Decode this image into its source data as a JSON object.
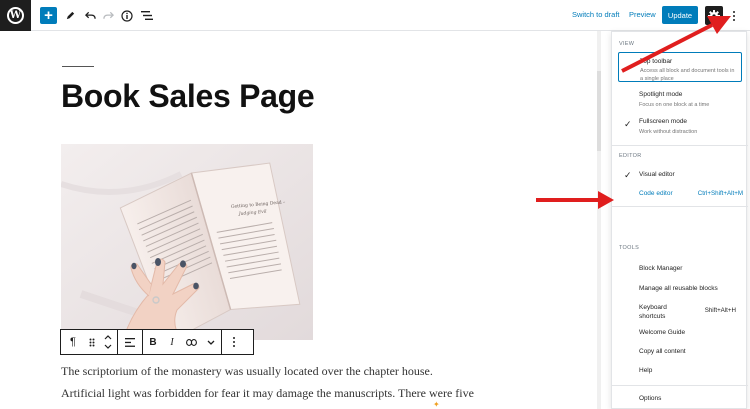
{
  "header": {
    "switch_to_draft": "Switch to draft",
    "preview": "Preview",
    "update": "Update",
    "icons": [
      "wordpress-logo",
      "plus",
      "pencil",
      "undo",
      "redo",
      "info",
      "list-view",
      "gear",
      "more-vertical"
    ]
  },
  "post": {
    "title": "Book Sales Page",
    "image": {
      "book_page_title": "Getting to Being Dead –",
      "book_page_subtitle": "Judging Evil"
    },
    "paragraphs": [
      "The scriptorium of the monastery was usually located over the chapter house.",
      "Artificial light was forbidden for fear it may damage the manuscripts. There were five"
    ]
  },
  "block_toolbar": {
    "icons": [
      "paragraph",
      "drag-handle",
      "move-up-down",
      "align",
      "bold",
      "italic",
      "link",
      "chevron-down",
      "more-vertical"
    ],
    "bold": "B",
    "italic": "I"
  },
  "menu": {
    "view": {
      "heading": "VIEW",
      "items": [
        {
          "label": "Top toolbar",
          "description": "Access all block and document tools in a single place",
          "checked": false,
          "focused": true
        },
        {
          "label": "Spotlight mode",
          "description": "Focus on one block at a time",
          "checked": false
        },
        {
          "label": "Fullscreen mode",
          "description": "Work without distraction",
          "checked": true
        }
      ]
    },
    "editor": {
      "heading": "EDITOR",
      "items": [
        {
          "label": "Visual editor",
          "checked": true
        },
        {
          "label": "Code editor",
          "shortcut": "Ctrl+Shift+Alt+M",
          "highlighted": true
        }
      ]
    },
    "tools": {
      "heading": "TOOLS",
      "items": [
        {
          "label": "Block Manager"
        },
        {
          "label": "Manage all reusable blocks"
        },
        {
          "label": "Keyboard shortcuts",
          "shortcut": "Shift+Alt+H"
        },
        {
          "label": "Welcome Guide"
        },
        {
          "label": "Copy all content"
        },
        {
          "label": "Help"
        }
      ]
    },
    "options": "Options"
  },
  "colors": {
    "accent": "#007cba",
    "dark": "#1e1e1e",
    "annotation_arrow": "#e01e1e"
  }
}
